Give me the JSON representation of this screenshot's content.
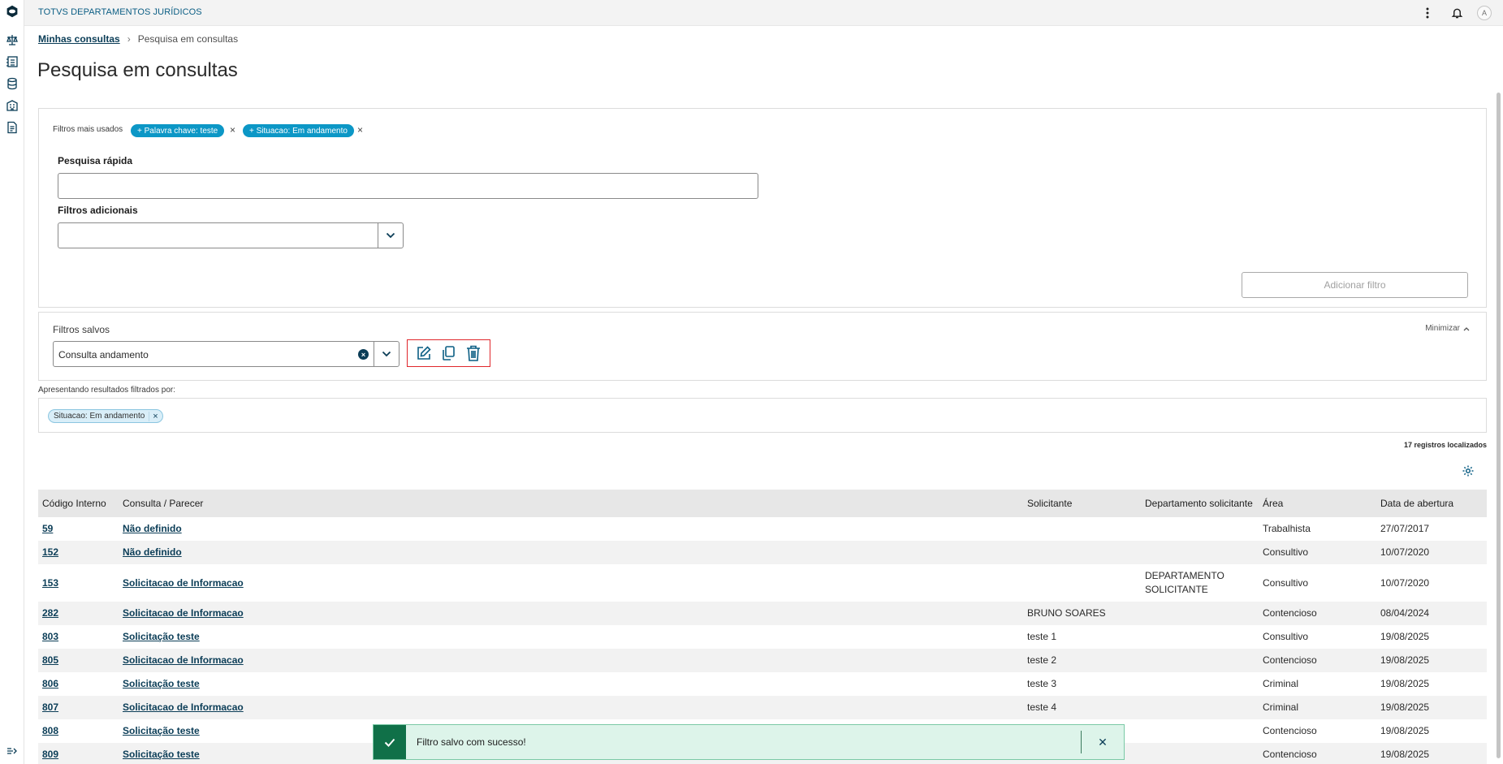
{
  "app": {
    "title": "TOTVS DEPARTAMENTOS JURÍDICOS"
  },
  "topbar": {
    "avatar_initial": "A"
  },
  "breadcrumb": {
    "root": "Minhas consultas",
    "separator": "›",
    "current": "Pesquisa em consultas"
  },
  "page": {
    "title": "Pesquisa em consultas"
  },
  "filters": {
    "most_used_label": "Filtros mais usados",
    "chips": [
      {
        "label": "+ Palavra chave: teste"
      },
      {
        "label": "+ Situacao: Em andamento"
      }
    ],
    "quick_search_label": "Pesquisa rápida",
    "quick_search_value": "",
    "additional_label": "Filtros adicionais",
    "additional_value": "",
    "add_button": "Adicionar filtro"
  },
  "saved_filters": {
    "title": "Filtros salvos",
    "minimize_label": "Minimizar",
    "selected": "Consulta andamento"
  },
  "results": {
    "label": "Apresentando resultados filtrados por:",
    "applied_chip": "Situacao: Em andamento",
    "count": "17 registros localizados"
  },
  "table": {
    "headers": [
      "Código Interno",
      "Consulta / Parecer",
      "Solicitante",
      "Departamento solicitante",
      "Área",
      "Data de abertura"
    ],
    "rows": [
      {
        "code": "59",
        "subject": "Não definido",
        "requester": "",
        "department": "",
        "area": "Trabalhista",
        "date": "27/07/2017"
      },
      {
        "code": "152",
        "subject": "Não definido",
        "requester": "",
        "department": "",
        "area": "Consultivo",
        "date": "10/07/2020"
      },
      {
        "code": "153",
        "subject": "Solicitacao de Informacao",
        "requester": "",
        "department": "DEPARTAMENTO SOLICITANTE",
        "area": "Consultivo",
        "date": "10/07/2020"
      },
      {
        "code": "282",
        "subject": "Solicitacao de Informacao",
        "requester": "BRUNO SOARES",
        "department": "",
        "area": "Contencioso",
        "date": "08/04/2024"
      },
      {
        "code": "803",
        "subject": "Solicitação teste",
        "requester": "teste 1",
        "department": "",
        "area": "Consultivo",
        "date": "19/08/2025"
      },
      {
        "code": "805",
        "subject": "Solicitacao de Informacao",
        "requester": "teste 2",
        "department": "",
        "area": "Contencioso",
        "date": "19/08/2025"
      },
      {
        "code": "806",
        "subject": "Solicitação teste",
        "requester": "teste 3",
        "department": "",
        "area": "Criminal",
        "date": "19/08/2025"
      },
      {
        "code": "807",
        "subject": "Solicitacao de Informacao",
        "requester": "teste 4",
        "department": "",
        "area": "Criminal",
        "date": "19/08/2025"
      },
      {
        "code": "808",
        "subject": "Solicitação teste",
        "requester": "",
        "department": "",
        "area": "Contencioso",
        "date": "19/08/2025"
      },
      {
        "code": "809",
        "subject": "Solicitação teste",
        "requester": "",
        "department": "",
        "area": "Contencioso",
        "date": "19/08/2025"
      }
    ]
  },
  "toast": {
    "message": "Filtro salvo com sucesso!",
    "type": "success"
  },
  "colors": {
    "primary": "#0b3d57",
    "accent": "#0c97c6",
    "success": "#107048",
    "highlight": "#e0262b"
  },
  "icons": [
    "logo-icon",
    "scales-icon",
    "report-icon",
    "database-icon",
    "building-icon",
    "document-icon",
    "expand-menu-icon",
    "more-vertical-icon",
    "bell-icon",
    "edit-icon",
    "copy-icon",
    "trash-icon",
    "gear-icon",
    "check-icon",
    "close-icon",
    "chevron-down-icon",
    "chevron-up-icon",
    "clear-icon"
  ]
}
